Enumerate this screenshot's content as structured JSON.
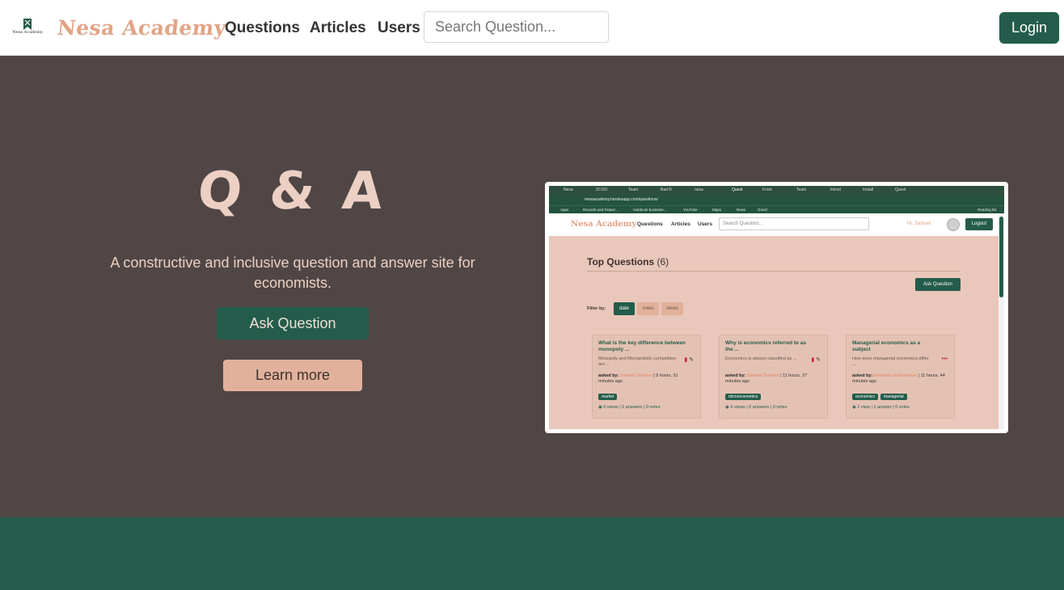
{
  "navbar": {
    "logo_text": "Nesa Academy",
    "brand": "Nesa Academy",
    "links": [
      "Questions",
      "Articles",
      "Users"
    ],
    "search_placeholder": "Search Question...",
    "login_label": "Login"
  },
  "hero": {
    "title": "Q & A",
    "tagline": "A constructive and inclusive question and answer site for economists.",
    "ask_label": "Ask Question",
    "learn_label": "Learn more"
  },
  "preview": {
    "tabs": [
      "Nesa",
      "ZCOO",
      "Team",
      "Bad R",
      "nesa",
      "Quest",
      "Front",
      "Team",
      "Introd",
      "Install",
      "Quest"
    ],
    "url": "nesaacademy.herokuapp.com/questions/",
    "bookmarks": [
      "Apps",
      "Records and Financ...",
      "notebook business...",
      "YouTube",
      "Maps",
      "News",
      "Gmail",
      "Reading list"
    ],
    "brand": "Nesa Academy",
    "links": [
      "Questions",
      "Articles",
      "Users"
    ],
    "search_placeholder": "Search Question...",
    "greeting": "Hi, Samuel",
    "logout": "Logout",
    "heading": "Top Questions",
    "count": "(6)",
    "ask": "Ask Question",
    "filter_label": "Filter by:",
    "filters": [
      "date",
      "votes",
      "views"
    ],
    "asked_by_label": "asked by:",
    "cards": [
      {
        "title": "What is the key difference between monopoly ...",
        "excerpt": "Monopoly and Monopolistic competition are ...",
        "author": "Samuel Torimiro",
        "time": "9 hours, 31 minutes ago",
        "tags": [
          "market"
        ],
        "stats": "0 views | 0 answers | 0 votes"
      },
      {
        "title": "Why is economics referred to as the ...",
        "excerpt": "Economics is always classified as ...",
        "author": "Samuel Torimiro",
        "time": "11 hours, 37 minutes ago",
        "tags": [
          "microeconomics"
        ],
        "stats": "0 views | 0 answers | 0 votes"
      },
      {
        "title": "Managerial economics as a subject",
        "excerpt": "How does managerial economics differ ...",
        "author": "kemisola oladunmoye",
        "time": "11 hours, 44 minutes ago",
        "tags": [
          "economics",
          "managerial"
        ],
        "stats": "1 view | 1 answer | 0 votes"
      }
    ]
  },
  "colors": {
    "brand_green": "#245c4b",
    "hero_bg": "#504645",
    "accent_peach": "#e2a487",
    "light_text": "#ecd0c4"
  }
}
